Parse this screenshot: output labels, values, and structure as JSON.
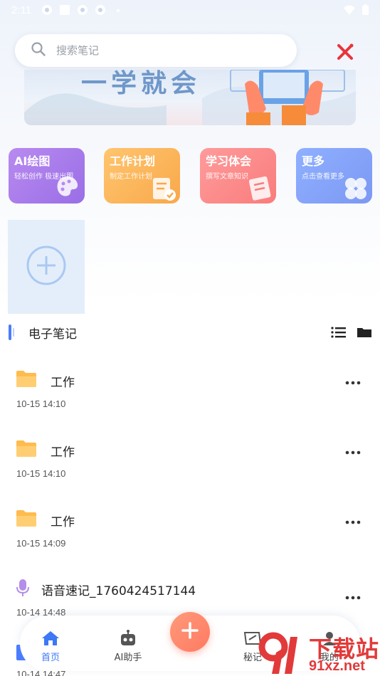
{
  "status_bar": {
    "time": "2:11"
  },
  "search": {
    "placeholder": "搜索笔记"
  },
  "banner": {
    "title_fragment": "一学就会"
  },
  "quick_actions": [
    {
      "title": "AI绘图",
      "subtitle": "轻松创作 极速出图",
      "icon": "palette-icon"
    },
    {
      "title": "工作计划",
      "subtitle": "制定工作计划",
      "icon": "checklist-icon"
    },
    {
      "title": "学习体会",
      "subtitle": "撰写文章知识",
      "icon": "document-icon"
    },
    {
      "title": "更多",
      "subtitle": "点击查看更多",
      "icon": "clover-icon"
    }
  ],
  "section": {
    "title": "电子笔记"
  },
  "notes": [
    {
      "type": "folder",
      "title": "工作",
      "date": "10-15 14:10"
    },
    {
      "type": "folder",
      "title": "工作",
      "date": "10-15 14:10"
    },
    {
      "type": "folder",
      "title": "工作",
      "date": "10-15 14:09"
    },
    {
      "type": "voice",
      "title": "语音速记_1760424517144",
      "date": "10-14 14:48"
    }
  ],
  "peek_note": {
    "date": "10-14 14:47"
  },
  "bottom_nav": {
    "home": "首页",
    "ai": "AI助手",
    "secret": "秘记",
    "mine": "我的"
  },
  "watermark": {
    "brand": "下载站",
    "url": "91xz.net"
  },
  "colors": {
    "accent": "#3d78f5",
    "fab": "#ff7a62",
    "folder": "#ffbb4d",
    "voice": "#b48ee8"
  }
}
